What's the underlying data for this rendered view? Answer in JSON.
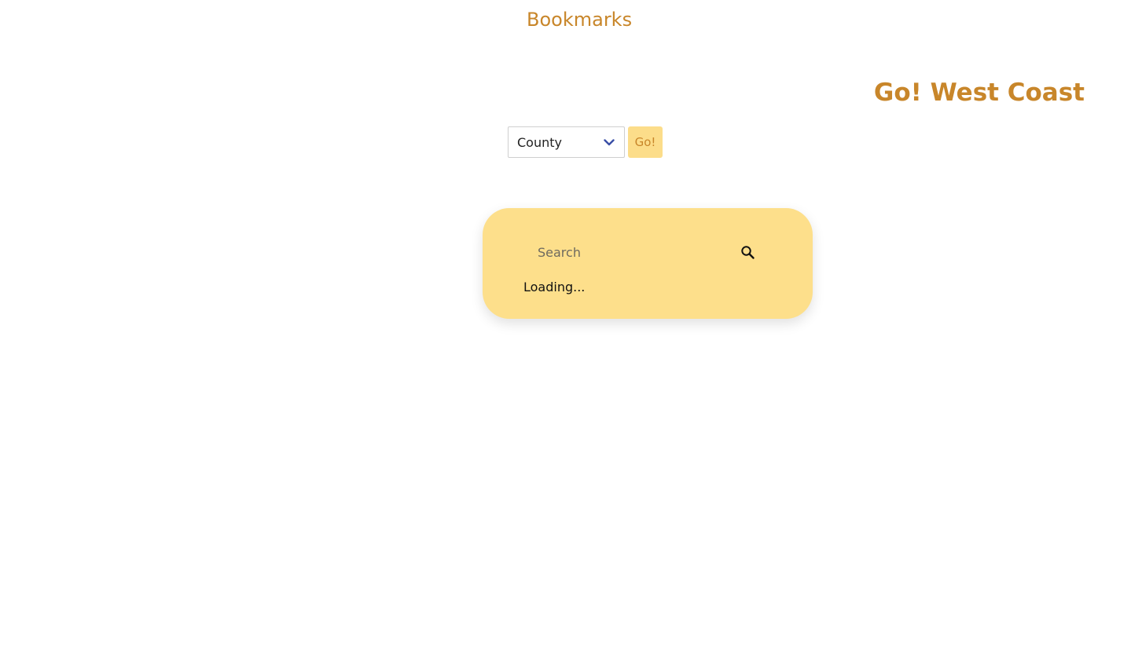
{
  "header": {
    "bookmarks_label": "Bookmarks",
    "brand_title": "Go! West Coast"
  },
  "filter": {
    "selected_value": "County",
    "go_label": "Go!"
  },
  "search": {
    "placeholder": "Search",
    "value": "",
    "status_text": "Loading..."
  },
  "icons": {
    "dropdown": "chevron-down-icon",
    "search": "search-icon"
  },
  "colors": {
    "brand": "#c8862a",
    "accent": "#fddf8b",
    "chevron": "#3a4fa6"
  }
}
